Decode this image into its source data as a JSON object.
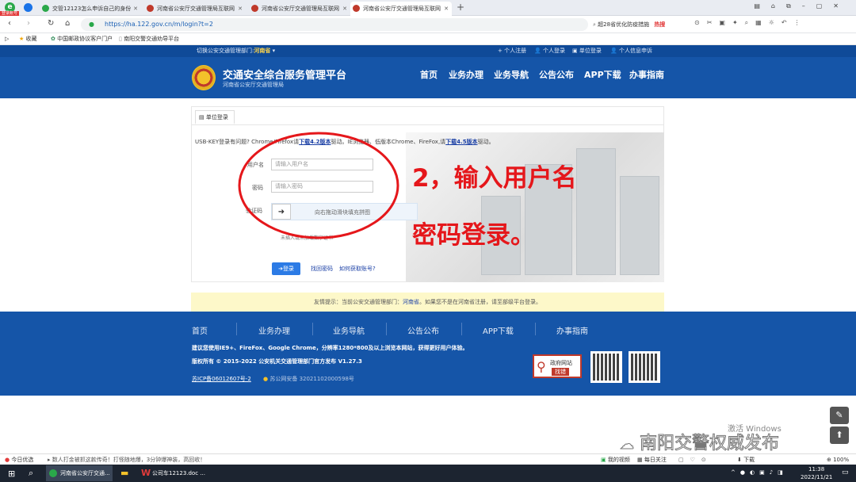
{
  "browser": {
    "badge": "登录账号",
    "tabs": [
      {
        "label": "交管12123怎么申诉自己的身份"
      },
      {
        "label": "河南省公安厅交通管理局互联网"
      },
      {
        "label": "河南省公安厅交通管理局互联网"
      },
      {
        "label": "河南省公安厅交通管理局互联网"
      }
    ],
    "url": "https://ha.122.gov.cn/m/login?t=2",
    "search": "超28省优化防疫措施",
    "hot": "热搜",
    "bookmarks": {
      "fav": "收藏",
      "b1": "中国邮政协议客户门户",
      "b2": "南阳交警交通劝导平台"
    }
  },
  "site": {
    "switch_label": "切换公安交通管理部门:",
    "province": "河南省",
    "top_links": [
      "个人注册",
      "个人登录",
      "单位登录",
      "个人信息申诉"
    ],
    "title": "交通安全综合服务管理平台",
    "subtitle": "河南省公安厅交通管理局",
    "nav": [
      "首页",
      "业务办理",
      "业务导航",
      "公告公布",
      "APP下载",
      "办事指南"
    ]
  },
  "login": {
    "tab": "单位登录",
    "usb_tip_1": "USB-KEY登录有问题? Chrome/Firefox请",
    "usb_tip_link1": "下载4.2版本",
    "usb_tip_2": "驱动。IE浏览器、低版本Chrome、FireFox,请",
    "usb_tip_link2": "下载4.5版本",
    "usb_tip_3": "驱动。",
    "username_label": "用户名",
    "username_placeholder": "请输入用户名",
    "password_label": "密码",
    "password_placeholder": "请输入密码",
    "captcha_label": "验证码",
    "slider_text": "向右拖动滑块填充拼图",
    "cert_text": "未插入或未加载数字证书",
    "login_button": "登录",
    "forgot": "找回密码",
    "get_account": "如何获取账号?",
    "annotation_line1": "2，输入用户名",
    "annotation_line2": "密码登录。"
  },
  "notice": {
    "prefix": "友情提示：当前公安交通管理部门：",
    "province": "河南省",
    "suffix": "。如果您不是在河南省注册，请至部级平台登录。"
  },
  "footer": {
    "nav": [
      "首页",
      "业务办理",
      "业务导航",
      "公告公布",
      "APP下载",
      "办事指南"
    ],
    "browser_tip": "建议您使用IE9+、FireFox、Google Chrome，分辨率1280*800及以上浏览本网站，获得更好用户体验。",
    "copyright": "版权所有 © 2015-2022 公安机关交通管理部门官方发布 V1.27.3",
    "icp": "苏ICP备06012607号-2",
    "police": "苏公网安备 32021102000598号",
    "gov_badge_1": "政府网站",
    "gov_badge_2": "找错"
  },
  "watermark": {
    "activate": "激活 Windows",
    "channel": "南阳交警权威发布"
  },
  "statusbar": {
    "left": "今日优选",
    "news": "数人打金被抓这款传奇！打怪随地爆，3分钟爆神装，高回收！",
    "video": "我的视频",
    "weather": "每日关注",
    "download": "下载",
    "zoom": "100%"
  },
  "taskbar": {
    "app1": "河南省公安厅交通...",
    "app2": "公司车12123.doc ...",
    "time": "11:38",
    "date": "2022/11/21"
  }
}
